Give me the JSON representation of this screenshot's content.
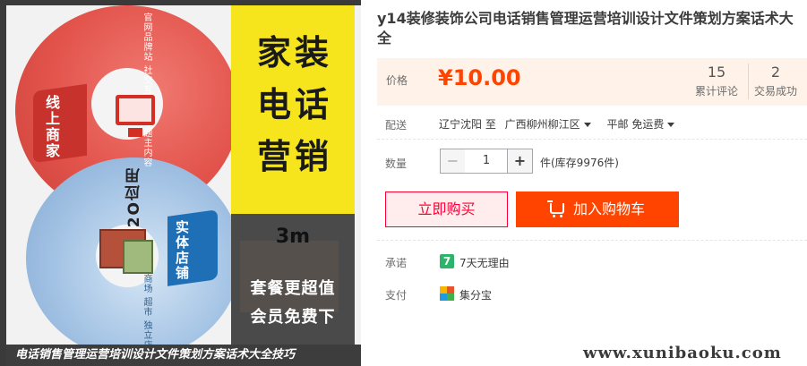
{
  "product_image": {
    "main_title": "家装电话营销",
    "size_label": "3m",
    "promo_line1": "套餐更超值",
    "promo_line2": "会员免费下",
    "banner_text": "电话销售管理运营培训设计文件策划方案话术大全技巧",
    "tag_online": "线上商家",
    "tag_offline": "实体店铺",
    "o2o_label": "O2O应用",
    "top_disc_text": "官网品牌站 社交互动页 专题主内容",
    "bottom_disc_text": "商场 超市 独立店"
  },
  "title": "y14装修装饰公司电话销售管理运营培训设计文件策划方案话术大全",
  "price": {
    "label": "价格",
    "currency": "¥",
    "value": "10.00",
    "reviews_count": "15",
    "reviews_label": "累计评论",
    "deals_count": "2",
    "deals_label": "交易成功"
  },
  "shipping": {
    "label": "配送",
    "from": "辽宁沈阳 至",
    "to": "广西柳州柳江区",
    "method": "平邮 免运费"
  },
  "quantity": {
    "label": "数量",
    "minus": "−",
    "value": "1",
    "plus": "+",
    "stock_text": "件(库存9976件)"
  },
  "actions": {
    "buy_now": "立即购买",
    "add_to_cart": "加入购物车"
  },
  "promise": {
    "label": "承诺",
    "icon_text": "7",
    "text": "7天无理由"
  },
  "payment": {
    "label": "支付",
    "text": "集分宝"
  },
  "watermark": "www.xunibaoku.com",
  "colors": {
    "price": "#ff4400",
    "add_to_cart_bg": "#ff4400",
    "buy_now_border": "#ff0036",
    "price_box_bg": "#fff2e8",
    "promise_icon": "#2db36b"
  },
  "icons": {
    "cart": "shopping-cart-icon",
    "promise": "seven-day-return-icon",
    "payment": "jifenbao-icon"
  }
}
